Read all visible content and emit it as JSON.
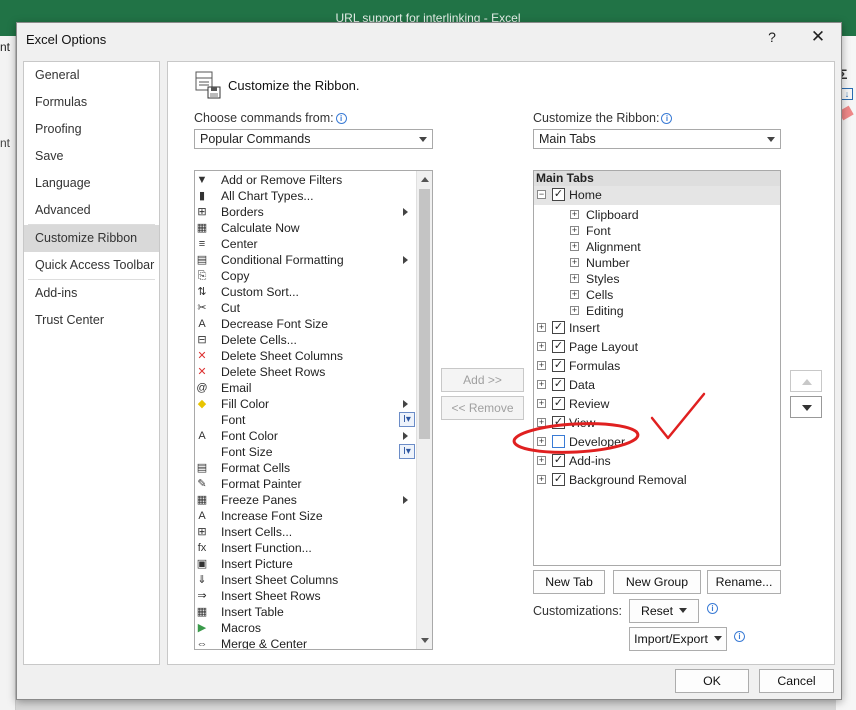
{
  "excel": {
    "window_title": "URL support for interlinking  -  Excel",
    "left_fragment_top": "nt",
    "left_fragment_mid": "nt"
  },
  "dialog": {
    "title": "Excel Options",
    "help_symbol": "?",
    "close_symbol": "✕"
  },
  "nav": {
    "items": [
      "General",
      "Formulas",
      "Proofing",
      "Save",
      "Language",
      "Advanced",
      "Customize Ribbon",
      "Quick Access Toolbar",
      "Add-ins",
      "Trust Center"
    ],
    "selected": "Customize Ribbon"
  },
  "header": {
    "title": "Customize the Ribbon."
  },
  "left_pane": {
    "label": "Choose commands from:",
    "dropdown_value": "Popular Commands",
    "commands": [
      {
        "label": "Add or Remove Filters",
        "icon": "filter-icon",
        "glyph": "▼"
      },
      {
        "label": "All Chart Types...",
        "icon": "chart-icon",
        "glyph": "▮"
      },
      {
        "label": "Borders",
        "icon": "borders-icon",
        "glyph": "⊞",
        "submenu": true
      },
      {
        "label": "Calculate Now",
        "icon": "calculator-icon",
        "glyph": "▦"
      },
      {
        "label": "Center",
        "icon": "center-align-icon",
        "glyph": "≡"
      },
      {
        "label": "Conditional Formatting",
        "icon": "conditional-formatting-icon",
        "glyph": "▤",
        "submenu": true
      },
      {
        "label": "Copy",
        "icon": "copy-icon",
        "glyph": "⎘"
      },
      {
        "label": "Custom Sort...",
        "icon": "sort-icon",
        "glyph": "⇅"
      },
      {
        "label": "Cut",
        "icon": "cut-icon",
        "glyph": "✂"
      },
      {
        "label": "Decrease Font Size",
        "icon": "decrease-font-icon",
        "glyph": "A"
      },
      {
        "label": "Delete Cells...",
        "icon": "delete-cells-icon",
        "glyph": "⊟"
      },
      {
        "label": "Delete Sheet Columns",
        "icon": "delete-columns-icon",
        "glyph": "✕"
      },
      {
        "label": "Delete Sheet Rows",
        "icon": "delete-rows-icon",
        "glyph": "✕"
      },
      {
        "label": "Email",
        "icon": "email-icon",
        "glyph": "@"
      },
      {
        "label": "Fill Color",
        "icon": "fill-color-icon",
        "glyph": "◆",
        "submenu": true
      },
      {
        "label": "Font",
        "icon": "font-icon",
        "glyph": "",
        "fontbox": true
      },
      {
        "label": "Font Color",
        "icon": "font-color-icon",
        "glyph": "A",
        "submenu": true
      },
      {
        "label": "Font Size",
        "icon": "font-size-icon",
        "glyph": "",
        "fontbox": true
      },
      {
        "label": "Format Cells",
        "icon": "format-cells-icon",
        "glyph": "▤"
      },
      {
        "label": "Format Painter",
        "icon": "format-painter-icon",
        "glyph": "✎"
      },
      {
        "label": "Freeze Panes",
        "icon": "freeze-panes-icon",
        "glyph": "▦",
        "submenu": true
      },
      {
        "label": "Increase Font Size",
        "icon": "increase-font-icon",
        "glyph": "A"
      },
      {
        "label": "Insert Cells...",
        "icon": "insert-cells-icon",
        "glyph": "⊞"
      },
      {
        "label": "Insert Function...",
        "icon": "insert-function-icon",
        "glyph": "fx"
      },
      {
        "label": "Insert Picture",
        "icon": "insert-picture-icon",
        "glyph": "▣"
      },
      {
        "label": "Insert Sheet Columns",
        "icon": "insert-columns-icon",
        "glyph": "⇓"
      },
      {
        "label": "Insert Sheet Rows",
        "icon": "insert-rows-icon",
        "glyph": "⇒"
      },
      {
        "label": "Insert Table",
        "icon": "insert-table-icon",
        "glyph": "▦"
      },
      {
        "label": "Macros",
        "icon": "macros-icon",
        "glyph": "▶"
      },
      {
        "label": "Merge & Center",
        "icon": "merge-center-icon",
        "glyph": "⇔"
      }
    ],
    "font_box_glyph": "I▾"
  },
  "middle": {
    "add_label": "Add >>",
    "remove_label": "<< Remove"
  },
  "right_pane": {
    "label": "Customize the Ribbon:",
    "dropdown_value": "Main Tabs",
    "tree_header": "Main Tabs",
    "home": {
      "label": "Home",
      "checked": true,
      "expanded": true,
      "groups": [
        "Clipboard",
        "Font",
        "Alignment",
        "Number",
        "Styles",
        "Cells",
        "Editing"
      ]
    },
    "tabs": [
      {
        "label": "Insert",
        "checked": true
      },
      {
        "label": "Page Layout",
        "checked": true
      },
      {
        "label": "Formulas",
        "checked": true
      },
      {
        "label": "Data",
        "checked": true
      },
      {
        "label": "Review",
        "checked": true
      },
      {
        "label": "View",
        "checked": true
      },
      {
        "label": "Developer",
        "checked": false
      },
      {
        "label": "Add-ins",
        "checked": true
      },
      {
        "label": "Background Removal",
        "checked": true
      }
    ],
    "new_tab_label": "New Tab",
    "new_group_label": "New Group",
    "rename_label": "Rename...",
    "customizations_label": "Customizations:",
    "reset_label": "Reset",
    "import_export_label": "Import/Export"
  },
  "footer": {
    "ok_label": "OK",
    "cancel_label": "Cancel"
  },
  "colors": {
    "excel_green": "#217346",
    "annotation_red": "#e02020"
  }
}
